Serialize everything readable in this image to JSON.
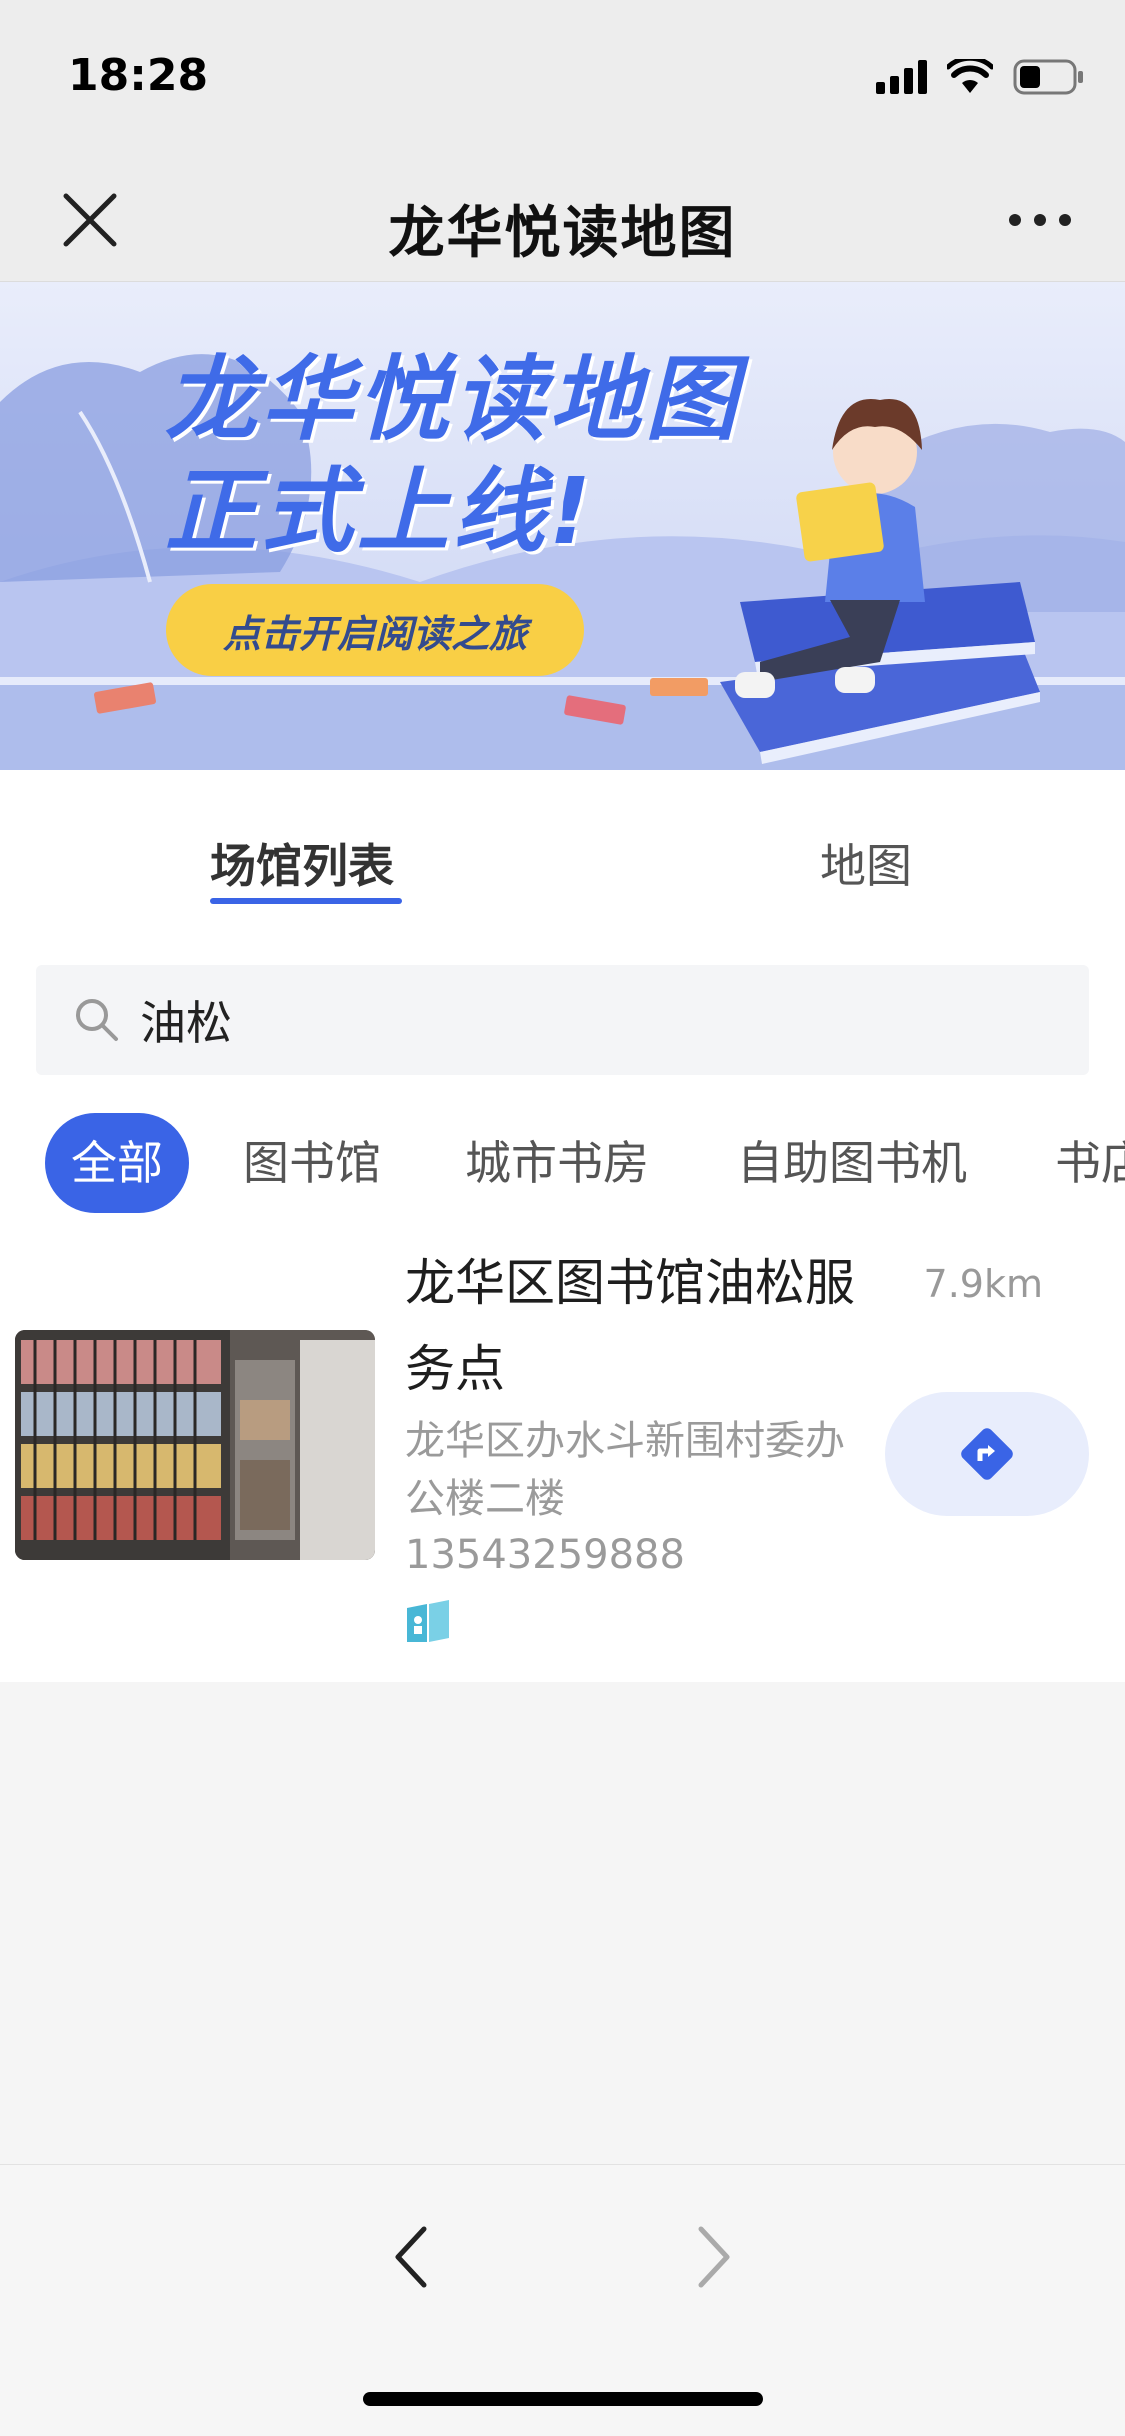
{
  "status_bar": {
    "time": "18:28"
  },
  "nav": {
    "title": "龙华悦读地图"
  },
  "banner": {
    "headline_line1": "龙华悦读地图",
    "headline_line2": "正式上线!",
    "cta_label": "点击开启阅读之旅"
  },
  "tabs": [
    {
      "label": "场馆列表",
      "active": true
    },
    {
      "label": "地图",
      "active": false
    }
  ],
  "search": {
    "value": "油松"
  },
  "filters": [
    {
      "label": "全部",
      "active": true
    },
    {
      "label": "图书馆",
      "active": false
    },
    {
      "label": "城市书房",
      "active": false
    },
    {
      "label": "自助图书机",
      "active": false
    },
    {
      "label": "书店",
      "active": false
    }
  ],
  "results": [
    {
      "name": "龙华区图书馆油松服务点",
      "distance": "7.9km",
      "address": "龙华区办水斗新围村委办公楼二楼",
      "phone": "13543259888"
    }
  ],
  "colors": {
    "accent": "#3a64e6",
    "cta_yellow": "#f9cf45",
    "nav_button_bg": "#e8edfc"
  },
  "icons": {
    "close": "close-icon",
    "more": "more-icon",
    "search": "search-icon",
    "navigate": "navigate-icon",
    "back": "chevron-left-icon",
    "forward": "chevron-right-icon"
  }
}
